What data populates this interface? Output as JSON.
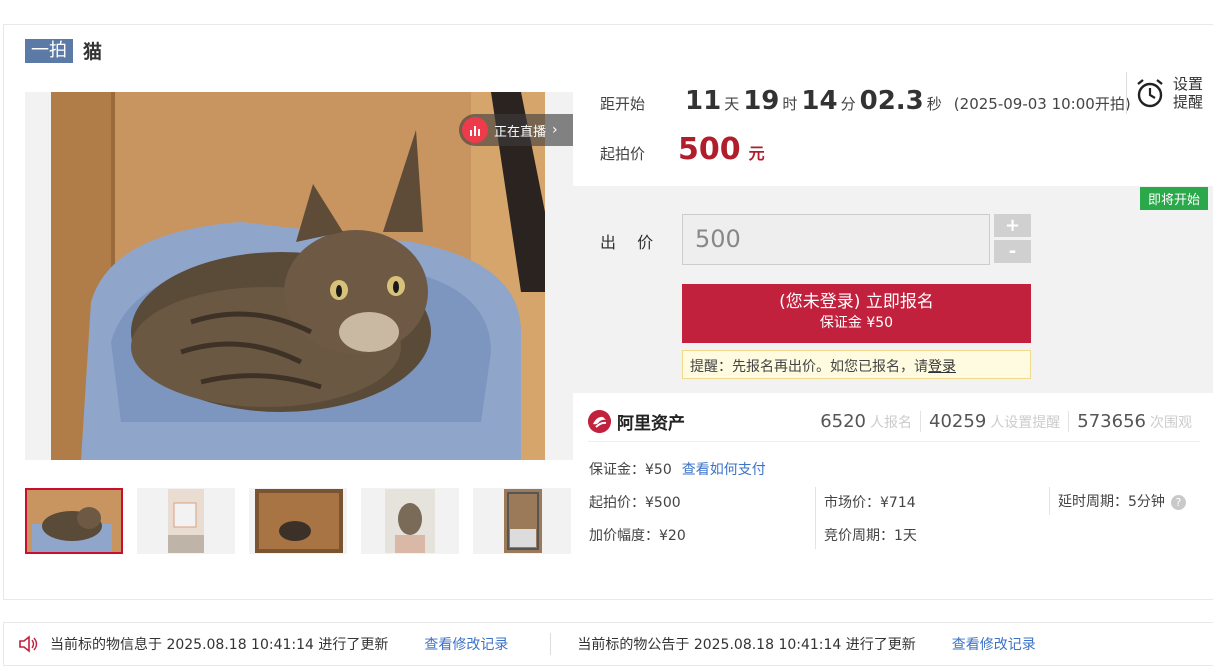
{
  "item": {
    "tag": "一拍",
    "title": "猫"
  },
  "media": {
    "live_label": "正在直播",
    "thumbnails": [
      "thumb-1",
      "thumb-2",
      "thumb-3",
      "thumb-4",
      "thumb-5"
    ]
  },
  "countdown": {
    "label": "距开始",
    "days": "11",
    "days_unit": "天",
    "hours": "19",
    "hours_unit": "时",
    "minutes": "14",
    "minutes_unit": "分",
    "seconds": "02.3",
    "seconds_unit": "秒",
    "start_note": "(2025-09-03 10:00开拍)"
  },
  "reminder": {
    "line1": "设置",
    "line2": "提醒"
  },
  "start_price": {
    "label": "起拍价",
    "value": "500",
    "unit": "元"
  },
  "bid": {
    "status_badge": "即将开始",
    "label": "出 价",
    "input_value": "500",
    "plus": "+",
    "minus": "-",
    "signup_line1": "(您未登录) 立即报名",
    "signup_line2": "保证金 ¥50",
    "tip_text": "提醒：先报名再出价。如您已报名，请",
    "tip_link": "登录"
  },
  "brand": {
    "name": "阿里资产"
  },
  "stats": [
    {
      "value": "6520",
      "label": "人报名"
    },
    {
      "value": "40259",
      "label": "人设置提醒"
    },
    {
      "value": "573656",
      "label": "次围观"
    }
  ],
  "details": {
    "deposit": "保证金：¥50",
    "deposit_link": "查看如何支付",
    "start_price": "起拍价：¥500",
    "market_price": "市场价：¥714",
    "delay_period": "延时周期：5分钟",
    "increment": "加价幅度：¥20",
    "bid_period": "竞价周期：1天",
    "help_glyph": "?"
  },
  "notices": {
    "info_text": "当前标的物信息于 2025.08.18 10:41:14 进行了更新",
    "info_link": "查看修改记录",
    "announcement_text": "当前标的物公告于 2025.08.18 10:41:14 进行了更新",
    "announcement_link": "查看修改记录"
  }
}
